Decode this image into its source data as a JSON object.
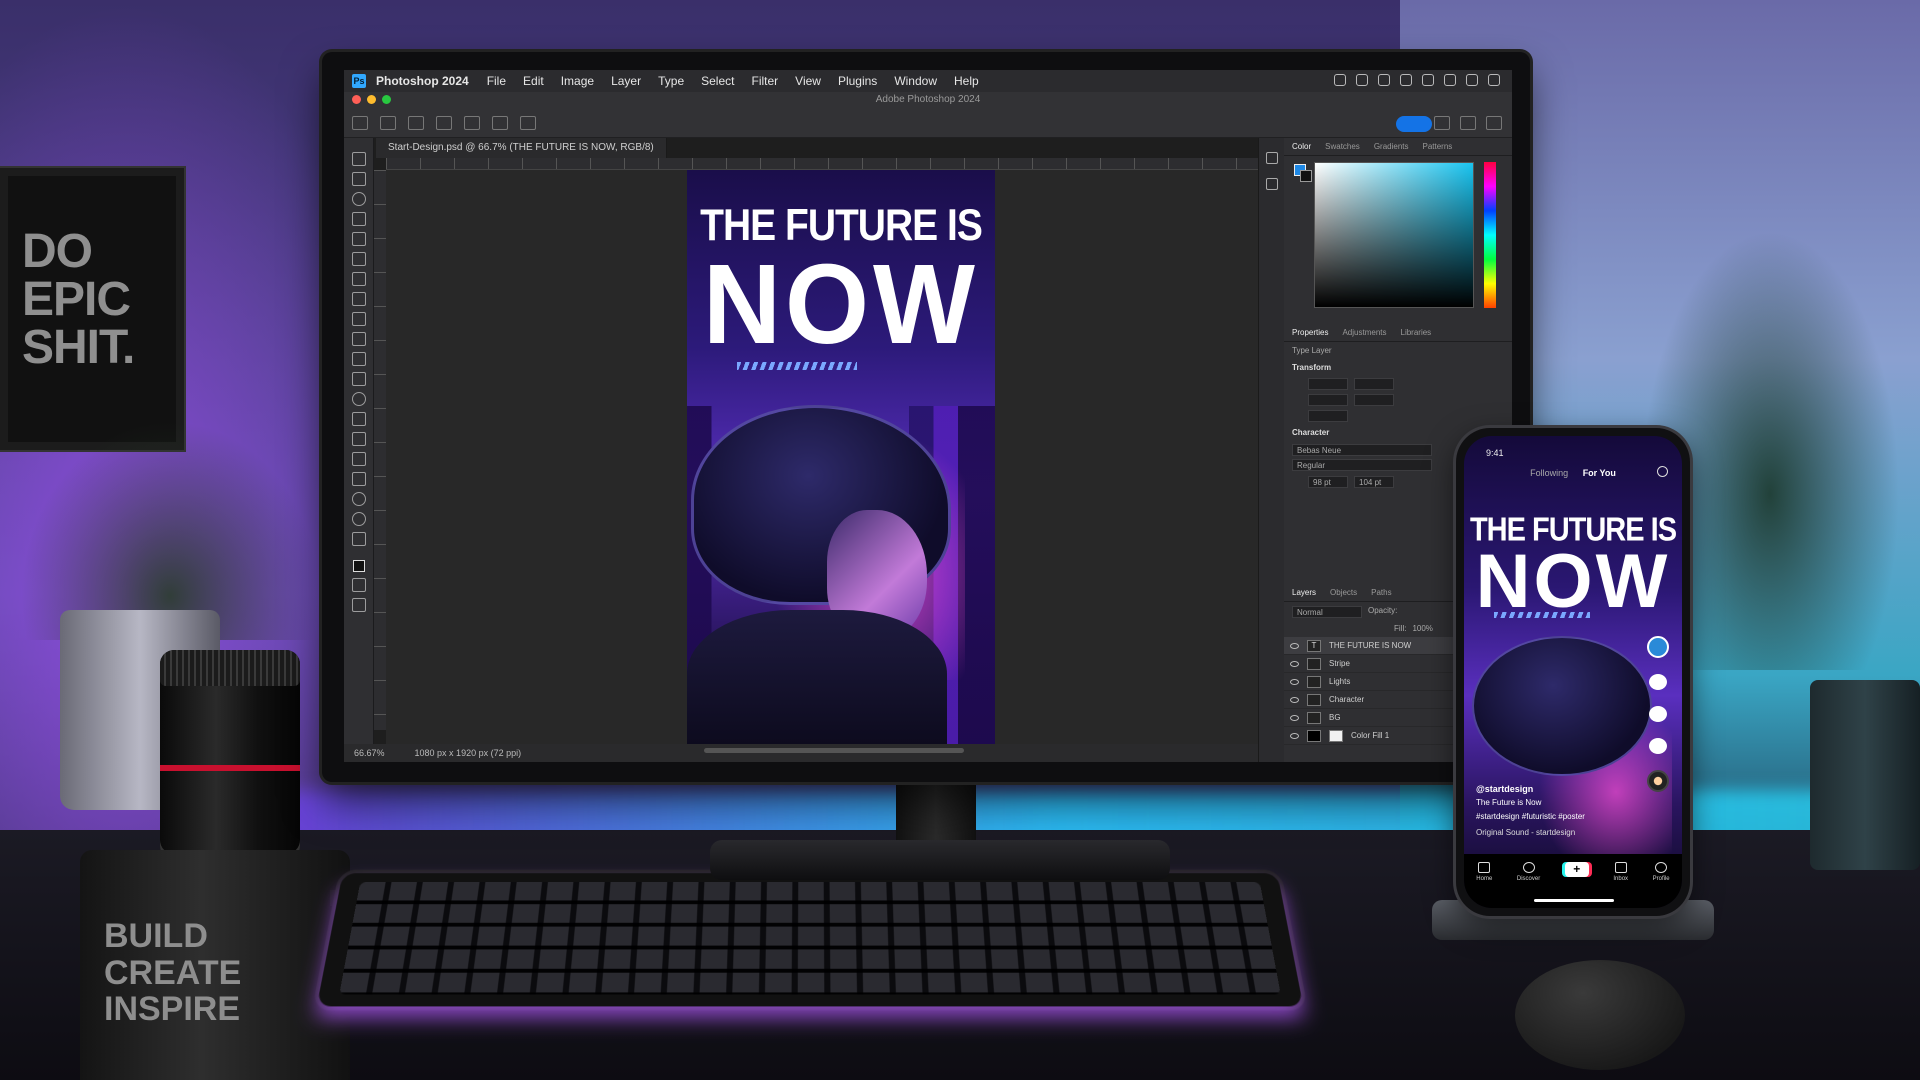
{
  "scene": {
    "poster_text": "DO EPIC SHIT.",
    "mug_text": "BUILD CREATE INSPIRE"
  },
  "photoshop": {
    "app_name": "Photoshop 2024",
    "menu": [
      "File",
      "Edit",
      "Image",
      "Layer",
      "Type",
      "Select",
      "Filter",
      "View",
      "Plugins",
      "Window",
      "Help"
    ],
    "window_title": "Adobe Photoshop 2024",
    "doc_tab": "Start-Design.psd @ 66.7% (THE FUTURE IS NOW, RGB/8)",
    "status_zoom": "66.67%",
    "status_info": "1080 px x 1920 px (72 ppi)",
    "artwork": {
      "line1": "THE FUTURE IS",
      "line2": "NOW"
    },
    "color_tabs": [
      "Color",
      "Swatches",
      "Gradients",
      "Patterns"
    ],
    "prop_tabs": [
      "Properties",
      "Adjustments",
      "Libraries"
    ],
    "layer_kind": "Type Layer",
    "transform_label": "Transform",
    "character_label": "Character",
    "font_family": "Bebas Neue",
    "font_style": "Regular",
    "font_size": "98 pt",
    "leading": "104 pt",
    "layers_tabs": [
      "Layers",
      "Objects",
      "Paths"
    ],
    "blend_mode": "Normal",
    "opacity_label": "Opacity:",
    "fill_label": "Fill:",
    "fill_value": "100%",
    "layers": [
      {
        "name": "THE FUTURE IS NOW",
        "thumb": "T",
        "selected": true
      },
      {
        "name": "Stripe",
        "thumb": "",
        "selected": false
      },
      {
        "name": "Lights",
        "thumb": "",
        "selected": false
      },
      {
        "name": "Character",
        "thumb": "",
        "selected": false
      },
      {
        "name": "BG",
        "thumb": "",
        "selected": false
      },
      {
        "name": "Color Fill 1",
        "thumb": "",
        "selected": false
      }
    ],
    "colors": {
      "accent": "#31a8ff",
      "share": "#1473e6"
    }
  },
  "phone": {
    "time": "9:41",
    "tab_following": "Following",
    "tab_foryou": "For You",
    "title1": "THE FUTURE IS",
    "title2": "NOW",
    "username": "@startdesign",
    "caption": "The Future is Now",
    "hashtags": "#startdesign #futuristic #poster",
    "sound": "Original Sound - startdesign",
    "nav": [
      "Home",
      "Discover",
      "",
      "Inbox",
      "Profile"
    ]
  }
}
